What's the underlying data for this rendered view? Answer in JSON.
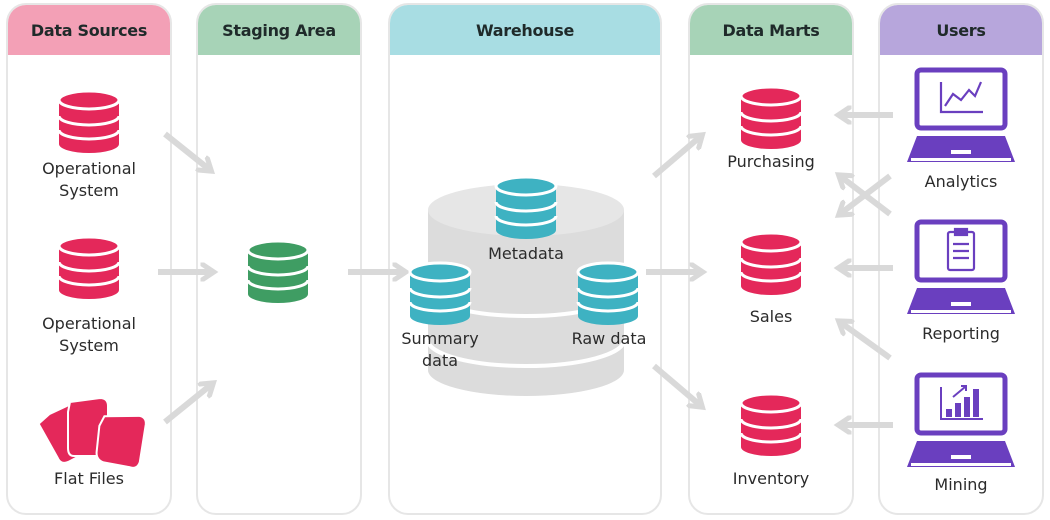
{
  "colors": {
    "data_sources_header": "#f3a0b6",
    "staging_header": "#a7d3b7",
    "warehouse_header": "#a8dde3",
    "data_marts_header": "#a7d3b7",
    "users_header": "#b7a6dc",
    "pink_db": "#e4285a",
    "green_db": "#3f9d63",
    "teal_db": "#3eb2c2",
    "purple_laptop": "#6a3fbf",
    "arrow": "#d9d9d9",
    "warehouse_cylinder": "#dcdcdc"
  },
  "columns": [
    {
      "id": "data-sources",
      "title": "Data Sources"
    },
    {
      "id": "staging-area",
      "title": "Staging Area"
    },
    {
      "id": "warehouse",
      "title": "Warehouse"
    },
    {
      "id": "data-marts",
      "title": "Data Marts"
    },
    {
      "id": "users",
      "title": "Users"
    }
  ],
  "data_sources": [
    {
      "label": "Operational\nSystem",
      "icon": "database-icon"
    },
    {
      "label": "Operational\nSystem",
      "icon": "database-icon"
    },
    {
      "label": "Flat Files",
      "icon": "files-icon"
    }
  ],
  "warehouse": {
    "metadata": "Metadata",
    "summary": "Summary\ndata",
    "raw": "Raw data"
  },
  "data_marts": [
    {
      "label": "Purchasing"
    },
    {
      "label": "Sales"
    },
    {
      "label": "Inventory"
    }
  ],
  "users": [
    {
      "label": "Analytics",
      "icon": "line-chart-icon"
    },
    {
      "label": "Reporting",
      "icon": "clipboard-icon"
    },
    {
      "label": "Mining",
      "icon": "bar-chart-icon"
    }
  ]
}
